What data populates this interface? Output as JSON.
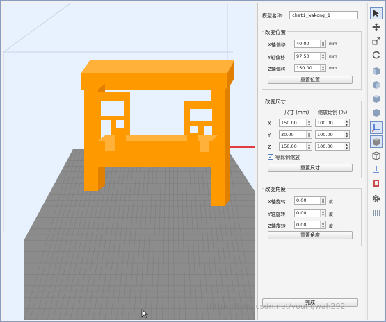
{
  "model": {
    "name_label": "模型名称:",
    "name_value": "cheti_wakong_1"
  },
  "position": {
    "title": "改变位置",
    "x_label": "X轴偏移",
    "x_value": "40.00",
    "y_label": "Y轴偏移",
    "y_value": "97.50",
    "z_label": "Z轴偏移",
    "z_value": "150.00",
    "unit": "mm",
    "reset_label": "重置位置"
  },
  "size": {
    "title": "改变尺寸",
    "col_size": "尺寸 (mm)",
    "col_scale": "缩放比例 (%)",
    "rows": [
      {
        "axis": "X",
        "size": "150.00",
        "scale": "100.00"
      },
      {
        "axis": "Y",
        "size": "30.00",
        "scale": "100.00"
      },
      {
        "axis": "Z",
        "size": "150.00",
        "scale": "100.00"
      }
    ],
    "uniform_label": "等比例缩放",
    "uniform_checked": "✓",
    "reset_label": "重置尺寸"
  },
  "rotation": {
    "title": "改变角度",
    "x_label": "X轴旋转",
    "x_value": "0.00",
    "y_label": "Y轴旋转",
    "y_value": "0.00",
    "z_label": "Z轴旋转",
    "z_value": "0.00",
    "unit": "度",
    "reset_label": "重置角度"
  },
  "done_label": "完成",
  "watermark": "https://blog.csdn.net/youngwah292",
  "colors": {
    "model": "#ff9900",
    "model_dark": "#e07f00",
    "plate": "#8c8c8c",
    "plate_grid": "#7a7a7a",
    "viewport_bg": "#e8f2ff"
  },
  "toolbar_icons": [
    "select-icon",
    "move-icon",
    "scale-icon",
    "rotate-icon",
    "view-front-icon",
    "view-back-icon",
    "view-left-icon",
    "view-right-icon",
    "view-top-icon",
    "axis-icon",
    "view-iso-icon",
    "wireframe-icon",
    "axis-z-icon",
    "support-icon",
    "settings-icon",
    "slice-icon"
  ]
}
